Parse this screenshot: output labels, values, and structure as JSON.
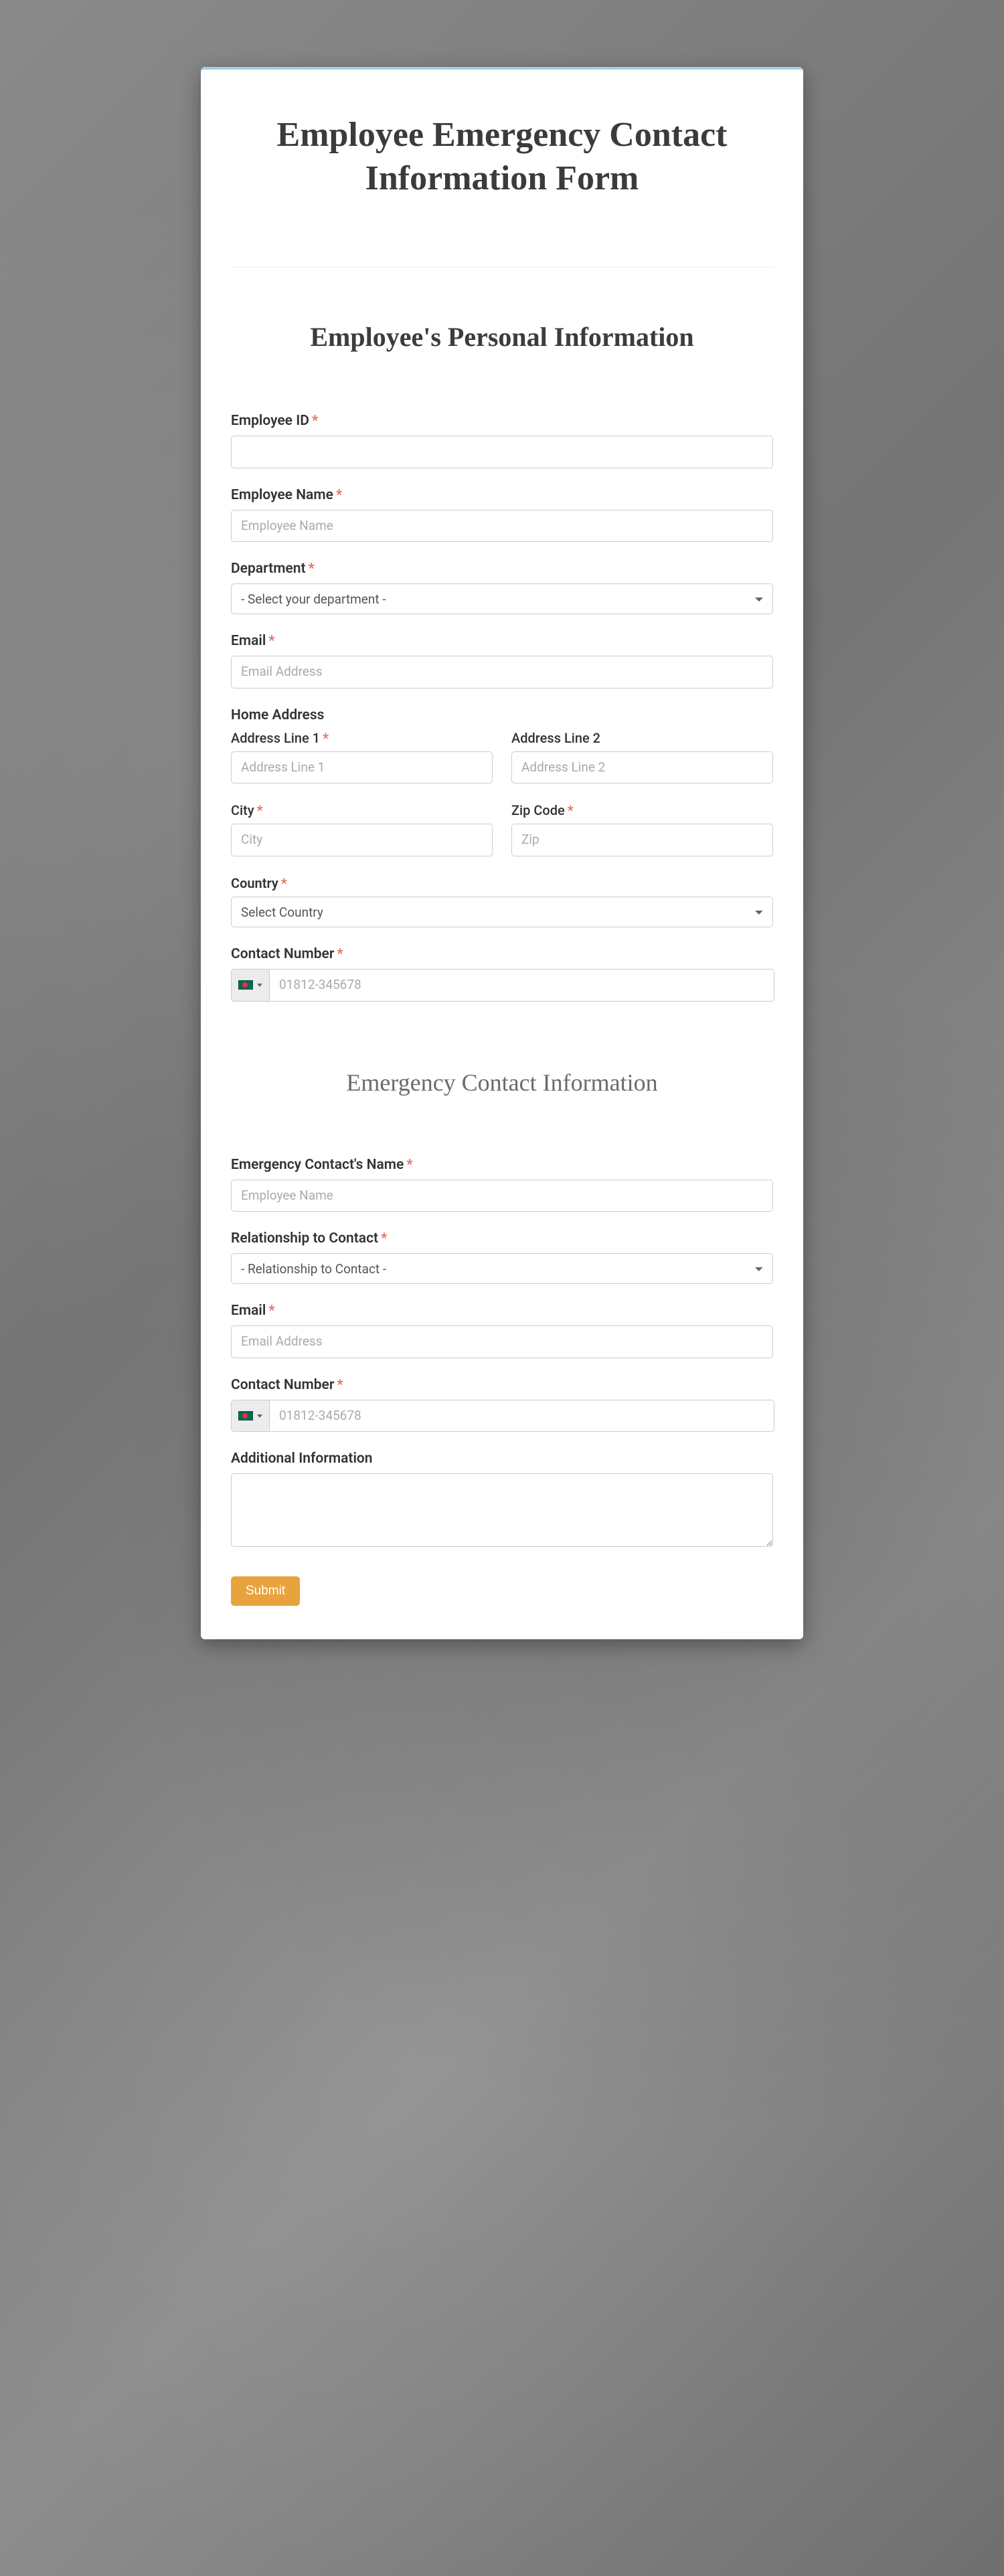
{
  "form": {
    "title": "Employee Emergency Contact Information Form",
    "section1_title": "Employee's Personal Information",
    "section2_title": "Emergency Contact Information",
    "submit_label": "Submit"
  },
  "fields": {
    "employee_id": {
      "label": "Employee ID"
    },
    "employee_name": {
      "label": "Employee Name",
      "placeholder": "Employee Name"
    },
    "department": {
      "label": "Department",
      "selected": "- Select your department -"
    },
    "email": {
      "label": "Email",
      "placeholder": "Email Address"
    },
    "home_address": {
      "label": "Home Address"
    },
    "addr1": {
      "label": "Address Line 1",
      "placeholder": "Address Line 1"
    },
    "addr2": {
      "label": "Address Line 2",
      "placeholder": "Address Line 2"
    },
    "city": {
      "label": "City",
      "placeholder": "City"
    },
    "zip": {
      "label": "Zip Code",
      "placeholder": "Zip"
    },
    "country": {
      "label": "Country",
      "selected": "Select Country"
    },
    "phone": {
      "label": "Contact Number",
      "placeholder": "01812-345678"
    },
    "ec_name": {
      "label": "Emergency Contact's Name",
      "placeholder": "Employee Name"
    },
    "ec_relation": {
      "label": "Relationship to Contact",
      "selected": "- Relationship to Contact -"
    },
    "ec_email": {
      "label": "Email",
      "placeholder": "Email Address"
    },
    "ec_phone": {
      "label": "Contact Number",
      "placeholder": "01812-345678"
    },
    "additional": {
      "label": "Additional Information"
    }
  }
}
